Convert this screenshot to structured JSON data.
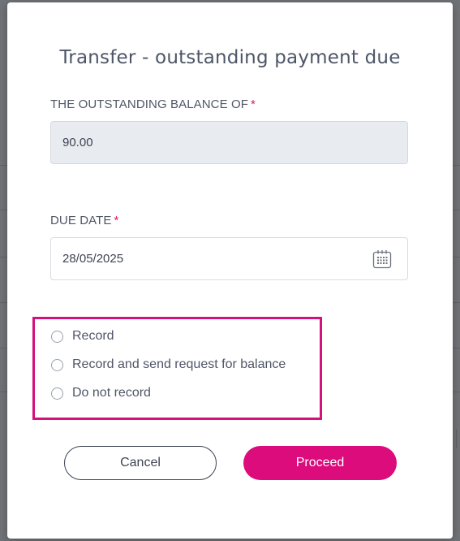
{
  "dialog": {
    "title": "Transfer - outstanding payment due",
    "balance": {
      "label": "THE OUTSTANDING BALANCE OF",
      "required_mark": "*",
      "value": "90.00"
    },
    "due_date": {
      "label": "DUE DATE",
      "required_mark": "*",
      "value": "28/05/2025",
      "icon": "calendar-icon"
    },
    "options": [
      {
        "label": "Record",
        "selected": false
      },
      {
        "label": "Record and send request for balance",
        "selected": false
      },
      {
        "label": "Do not record",
        "selected": false
      }
    ],
    "buttons": {
      "cancel": "Cancel",
      "proceed": "Proceed"
    }
  },
  "colors": {
    "accent": "#dc0c7c",
    "highlight_border": "#d4127a",
    "required": "#d81b6a",
    "overlay": "#6f7276",
    "readonly_bg": "#e8ebef"
  }
}
